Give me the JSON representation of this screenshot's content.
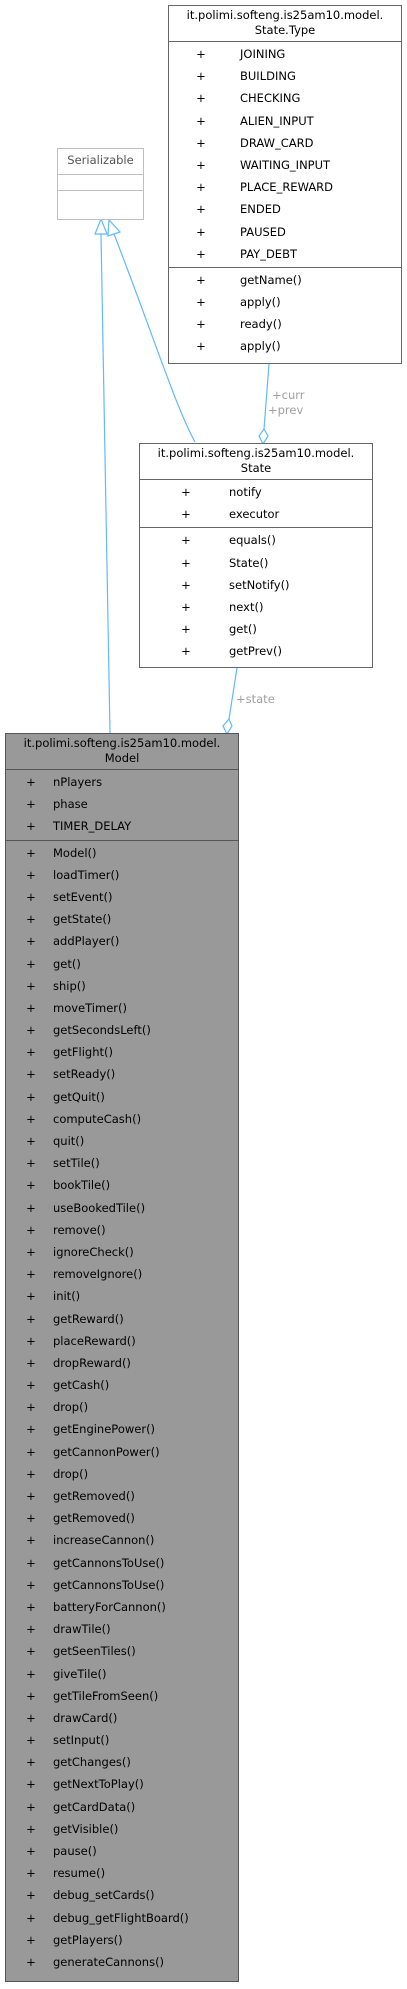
{
  "interface": {
    "name": "Serializable"
  },
  "state_type": {
    "title_line1": "it.polimi.softeng.is25am10.model.",
    "title_line2": "State.Type",
    "attributes": [
      {
        "vis": "+",
        "name": "JOINING"
      },
      {
        "vis": "+",
        "name": "BUILDING"
      },
      {
        "vis": "+",
        "name": "CHECKING"
      },
      {
        "vis": "+",
        "name": "ALIEN_INPUT"
      },
      {
        "vis": "+",
        "name": "DRAW_CARD"
      },
      {
        "vis": "+",
        "name": "WAITING_INPUT"
      },
      {
        "vis": "+",
        "name": "PLACE_REWARD"
      },
      {
        "vis": "+",
        "name": "ENDED"
      },
      {
        "vis": "+",
        "name": "PAUSED"
      },
      {
        "vis": "+",
        "name": "PAY_DEBT"
      }
    ],
    "methods": [
      {
        "vis": "+",
        "name": "getName()"
      },
      {
        "vis": "+",
        "name": "apply()"
      },
      {
        "vis": "+",
        "name": "ready()"
      },
      {
        "vis": "+",
        "name": "apply()"
      }
    ]
  },
  "state": {
    "title_line1": "it.polimi.softeng.is25am10.model.",
    "title_line2": "State",
    "attributes": [
      {
        "vis": "+",
        "name": "notify"
      },
      {
        "vis": "+",
        "name": "executor"
      }
    ],
    "methods": [
      {
        "vis": "+",
        "name": "equals()"
      },
      {
        "vis": "+",
        "name": "State()"
      },
      {
        "vis": "+",
        "name": "setNotify()"
      },
      {
        "vis": "+",
        "name": "next()"
      },
      {
        "vis": "+",
        "name": "get()"
      },
      {
        "vis": "+",
        "name": "getPrev()"
      }
    ]
  },
  "model": {
    "title_line1": "it.polimi.softeng.is25am10.model.",
    "title_line2": "Model",
    "attributes": [
      {
        "vis": "+",
        "name": "nPlayers"
      },
      {
        "vis": "+",
        "name": "phase"
      },
      {
        "vis": "+",
        "name": "TIMER_DELAY"
      }
    ],
    "methods": [
      {
        "vis": "+",
        "name": "Model()"
      },
      {
        "vis": "+",
        "name": "loadTimer()"
      },
      {
        "vis": "+",
        "name": "setEvent()"
      },
      {
        "vis": "+",
        "name": "getState()"
      },
      {
        "vis": "+",
        "name": "addPlayer()"
      },
      {
        "vis": "+",
        "name": "get()"
      },
      {
        "vis": "+",
        "name": "ship()"
      },
      {
        "vis": "+",
        "name": "moveTimer()"
      },
      {
        "vis": "+",
        "name": "getSecondsLeft()"
      },
      {
        "vis": "+",
        "name": "getFlight()"
      },
      {
        "vis": "+",
        "name": "setReady()"
      },
      {
        "vis": "+",
        "name": "getQuit()"
      },
      {
        "vis": "+",
        "name": "computeCash()"
      },
      {
        "vis": "+",
        "name": "quit()"
      },
      {
        "vis": "+",
        "name": "setTile()"
      },
      {
        "vis": "+",
        "name": "bookTile()"
      },
      {
        "vis": "+",
        "name": "useBookedTile()"
      },
      {
        "vis": "+",
        "name": "remove()"
      },
      {
        "vis": "+",
        "name": "ignoreCheck()"
      },
      {
        "vis": "+",
        "name": "removeIgnore()"
      },
      {
        "vis": "+",
        "name": "init()"
      },
      {
        "vis": "+",
        "name": "getReward()"
      },
      {
        "vis": "+",
        "name": "placeReward()"
      },
      {
        "vis": "+",
        "name": "dropReward()"
      },
      {
        "vis": "+",
        "name": "getCash()"
      },
      {
        "vis": "+",
        "name": "drop()"
      },
      {
        "vis": "+",
        "name": "getEnginePower()"
      },
      {
        "vis": "+",
        "name": "getCannonPower()"
      },
      {
        "vis": "+",
        "name": "drop()"
      },
      {
        "vis": "+",
        "name": "getRemoved()"
      },
      {
        "vis": "+",
        "name": "getRemoved()"
      },
      {
        "vis": "+",
        "name": "increaseCannon()"
      },
      {
        "vis": "+",
        "name": "getCannonsToUse()"
      },
      {
        "vis": "+",
        "name": "getCannonsToUse()"
      },
      {
        "vis": "+",
        "name": "batteryForCannon()"
      },
      {
        "vis": "+",
        "name": "drawTile()"
      },
      {
        "vis": "+",
        "name": "getSeenTiles()"
      },
      {
        "vis": "+",
        "name": "giveTile()"
      },
      {
        "vis": "+",
        "name": "getTileFromSeen()"
      },
      {
        "vis": "+",
        "name": "drawCard()"
      },
      {
        "vis": "+",
        "name": "setInput()"
      },
      {
        "vis": "+",
        "name": "getChanges()"
      },
      {
        "vis": "+",
        "name": "getNextToPlay()"
      },
      {
        "vis": "+",
        "name": "getCardData()"
      },
      {
        "vis": "+",
        "name": "getVisible()"
      },
      {
        "vis": "+",
        "name": "pause()"
      },
      {
        "vis": "+",
        "name": "resume()"
      },
      {
        "vis": "+",
        "name": "debug_setCards()"
      },
      {
        "vis": "+",
        "name": "debug_getFlightBoard()"
      },
      {
        "vis": "+",
        "name": "getPlayers()"
      },
      {
        "vis": "+",
        "name": "generateCannons()"
      }
    ]
  },
  "labels": {
    "curr": "+curr",
    "prev": "+prev",
    "state": "+state"
  },
  "colors": {
    "edge": "#63b8ff",
    "model_fill": "#999999",
    "label": "#a0a0a0"
  }
}
